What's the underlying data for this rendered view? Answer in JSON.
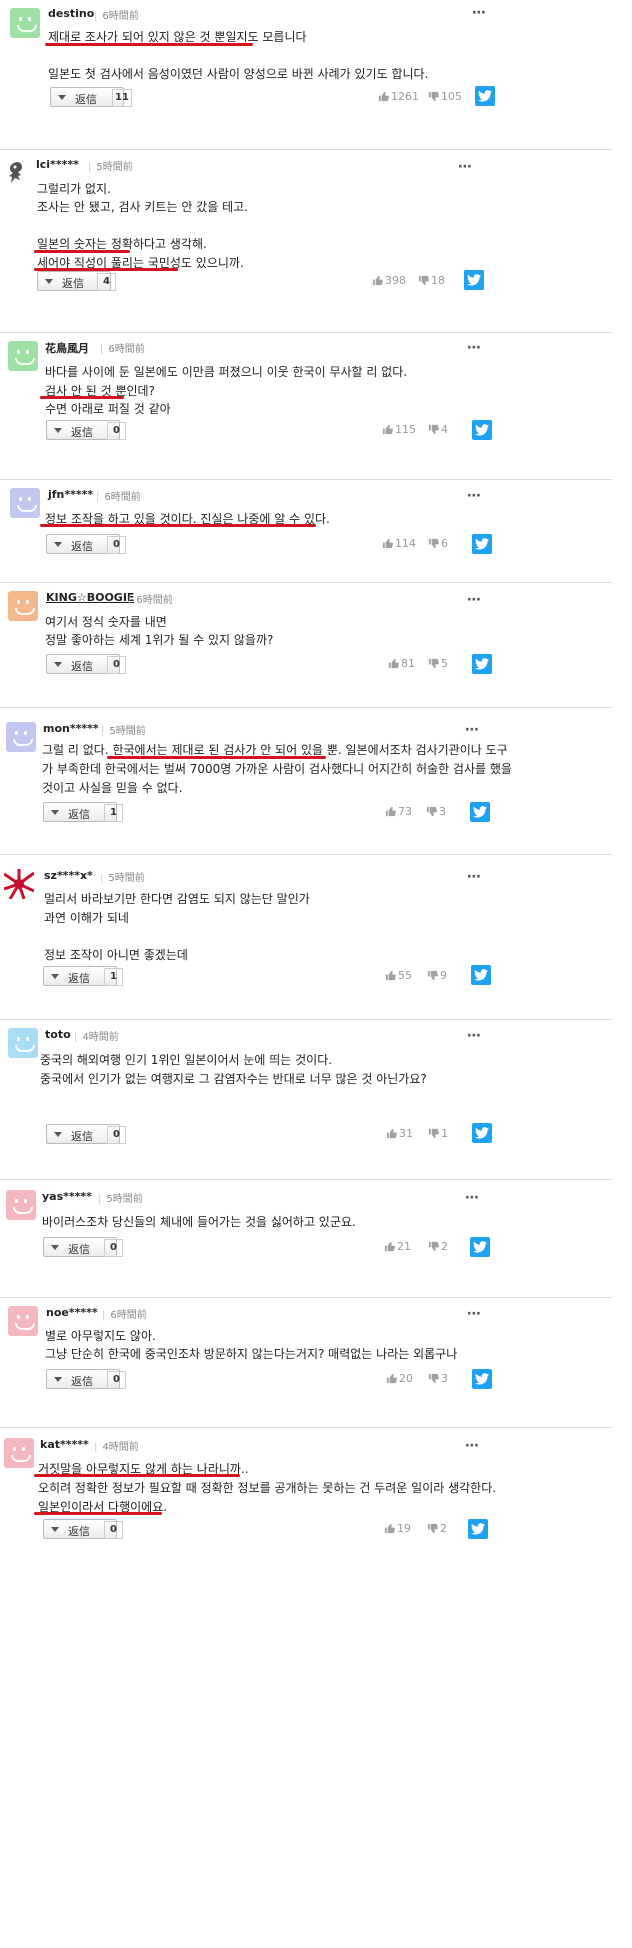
{
  "reply_label": "返信",
  "more_icon": "⋯",
  "comments": [
    {
      "user": "destino",
      "time": "6時間前",
      "lines": [
        "제대로 조사가 되어 있지 않은 것 뿐일지도 모릅니다",
        "",
        "일본도 첫 검사에서 음성이였던 사람이 양성으로 바뀐 사례가 있기도 합니다."
      ],
      "replies": "11",
      "up": "1261",
      "down": "105"
    },
    {
      "user": "lci*****",
      "time": "5時間前",
      "lines": [
        "그럴리가 없지.",
        "조사는 안 됐고, 검사 키트는 안 갔을 테고.",
        "",
        "일본의 숫자는 정확하다고 생각해.",
        "세어야 직성이 풀리는 국민성도 있으니까."
      ],
      "replies": "4",
      "up": "398",
      "down": "18"
    },
    {
      "user": "花鳥風月",
      "time": "6時間前",
      "lines": [
        "바다를 사이에 둔 일본에도 이만큼 퍼졌으니 이웃 한국이 무사할 리 없다.",
        "검사 안 된 것 뿐인데?",
        "수면 아래로 퍼질 것 같아"
      ],
      "replies": "0",
      "up": "115",
      "down": "4"
    },
    {
      "user": "jfn*****",
      "time": "6時間前",
      "lines": [
        "정보 조작을 하고 있을 것이다. 진실은 나중에 알 수 있다."
      ],
      "replies": "0",
      "up": "114",
      "down": "6"
    },
    {
      "user": "KING☆BOOGIE",
      "time": "6時間前",
      "lines": [
        "여기서 정식 숫자를 내면",
        "정말 좋아하는 세계 1위가 될 수 있지 않을까?"
      ],
      "replies": "0",
      "up": "81",
      "down": "5"
    },
    {
      "user": "mon*****",
      "time": "5時間前",
      "lines": [
        "그럴 리 없다. 한국에서는 제대로 된 검사가 안 되어 있을 뿐. 일본에서조차 검사기관이나 도구",
        "가 부족한데 한국에서는 벌써 7000명 가까운 사람이 검사했다니 어지간히 허술한 검사를 했을",
        "것이고 사실을 믿을 수 없다."
      ],
      "replies": "1",
      "up": "73",
      "down": "3"
    },
    {
      "user": "sz****x*",
      "time": "5時間前",
      "lines": [
        "멀리서 바라보기만 한다면 감염도 되지 않는단 말인가",
        "과연 이해가 되네",
        "",
        "정보 조작이 아니면 좋겠는데"
      ],
      "replies": "1",
      "up": "55",
      "down": "9"
    },
    {
      "user": "toto",
      "time": "4時間前",
      "lines": [
        "중국의 해외여행 인기 1위인 일본이어서 눈에 띄는 것이다.",
        "중국에서 인기가 없는 여행지로 그 감염자수는 반대로 너무 많은 것 아닌가요?"
      ],
      "replies": "0",
      "up": "31",
      "down": "1"
    },
    {
      "user": "yas*****",
      "time": "5時間前",
      "lines": [
        "바이러스조차 당신들의 체내에 들어가는 것을 싫어하고 있군요."
      ],
      "replies": "0",
      "up": "21",
      "down": "2"
    },
    {
      "user": "noe*****",
      "time": "6時間前",
      "lines": [
        "별로 아무렇지도 않아.",
        "그냥 단순히 한국에 중국인조차 방문하지 않는다는거지? 매력없는 나라는 외롭구나"
      ],
      "replies": "0",
      "up": "20",
      "down": "3"
    },
    {
      "user": "kat*****",
      "time": "4時間前",
      "lines": [
        "거짓말을 아무렇지도 않게 하는 나라니까..",
        "오히려 정확한 정보가 필요할 때 정확한 정보를 공개하는 못하는 건 두려운 일이라 생각한다.",
        "일본인이라서 다행이에요."
      ],
      "replies": "0",
      "up": "19",
      "down": "2"
    }
  ]
}
